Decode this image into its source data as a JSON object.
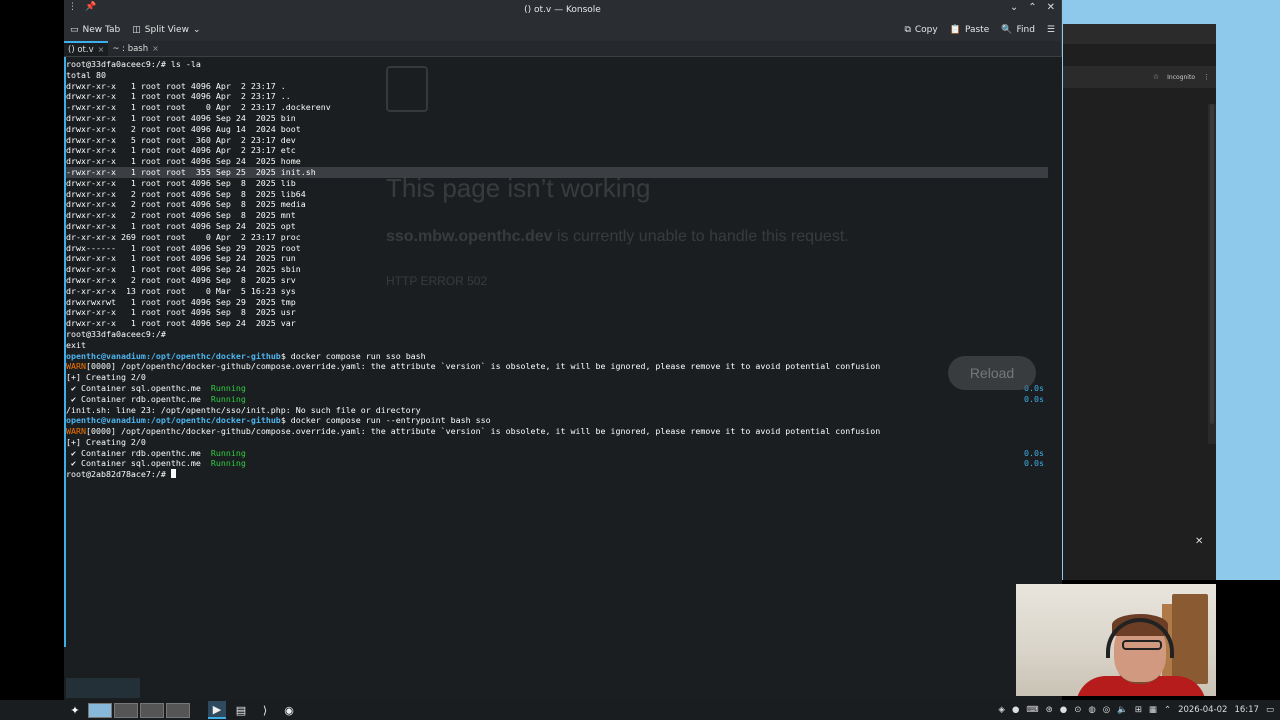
{
  "window": {
    "title": "() ot.v — Konsole",
    "toolbar": {
      "new_tab": "New Tab",
      "split_view": "Split View",
      "copy": "Copy",
      "paste": "Paste",
      "find": "Find"
    },
    "tabs": [
      {
        "label": "() ot.v"
      },
      {
        "label": "~ : bash"
      }
    ]
  },
  "terminal": {
    "lines": [
      "root@33dfa0aceec9:/# ls -la",
      "total 80",
      "drwxr-xr-x   1 root root 4096 Apr  2 23:17 .",
      "drwxr-xr-x   1 root root 4096 Apr  2 23:17 ..",
      "-rwxr-xr-x   1 root root    0 Apr  2 23:17 .dockerenv",
      "drwxr-xr-x   1 root root 4096 Sep 24  2025 bin",
      "drwxr-xr-x   2 root root 4096 Aug 14  2024 boot",
      "drwxr-xr-x   5 root root  360 Apr  2 23:17 dev",
      "drwxr-xr-x   1 root root 4096 Apr  2 23:17 etc",
      "drwxr-xr-x   1 root root 4096 Sep 24  2025 home",
      "-rwxr-xr-x   1 root root  355 Sep 25  2025 init.sh",
      "drwxr-xr-x   1 root root 4096 Sep  8  2025 lib",
      "drwxr-xr-x   2 root root 4096 Sep  8  2025 lib64",
      "drwxr-xr-x   2 root root 4096 Sep  8  2025 media",
      "drwxr-xr-x   2 root root 4096 Sep  8  2025 mnt",
      "drwxr-xr-x   1 root root 4096 Sep 24  2025 opt",
      "dr-xr-xr-x 269 root root    0 Apr  2 23:17 proc",
      "drwx------   1 root root 4096 Sep 29  2025 root",
      "drwxr-xr-x   1 root root 4096 Sep 24  2025 run",
      "drwxr-xr-x   1 root root 4096 Sep 24  2025 sbin",
      "drwxr-xr-x   2 root root 4096 Sep  8  2025 srv",
      "dr-xr-xr-x  13 root root    0 Mar  5 16:23 sys",
      "drwxrwxrwt   1 root root 4096 Sep 29  2025 tmp",
      "drwxr-xr-x   1 root root 4096 Sep  8  2025 usr",
      "drwxr-xr-x   1 root root 4096 Sep 24  2025 var",
      "root@33dfa0aceec9:/#",
      "exit"
    ],
    "prompt1_user": "openthc@vanadium",
    "prompt1_path": ":/opt/openthc/docker-github",
    "prompt1_cmd": "$ docker compose run sso bash",
    "warn_tag": "WARN",
    "warn_text": "[0000] /opt/openthc/docker-github/compose.override.yaml: the attribute `version` is obsolete, it will be ignored, please remove it to avoid potential confusion",
    "creating": "[+] Creating 2/0",
    "c1_name": " ✔ Container sql.openthc.me  ",
    "c1_status": "Running",
    "c1_time": "0.0s",
    "c2_name": " ✔ Container rdb.openthc.me  ",
    "c2_status": "Running",
    "c2_time": "0.0s",
    "error_line": "/init.sh: line 23: /opt/openthc/sso/init.php: No such file or directory",
    "prompt2_cmd": "$ docker compose run --entrypoint bash sso",
    "c3_name": " ✔ Container rdb.openthc.me  ",
    "c3_status": "Running",
    "c3_time": "0.0s",
    "c4_name": " ✔ Container sql.openthc.me  ",
    "c4_status": "Running",
    "c4_time": "0.0s",
    "final_prompt": "root@2ab82d78ace7:/# "
  },
  "ghost_page": {
    "heading": "This page isn’t working",
    "host": "sso.mbw.openthc.dev",
    "message": " is currently unable to handle this request.",
    "code": "HTTP ERROR 502",
    "reload": "Reload"
  },
  "chrome": {
    "incognito": "Incognito"
  },
  "panel": {
    "date": "2026-04-02",
    "time": "16:17"
  }
}
